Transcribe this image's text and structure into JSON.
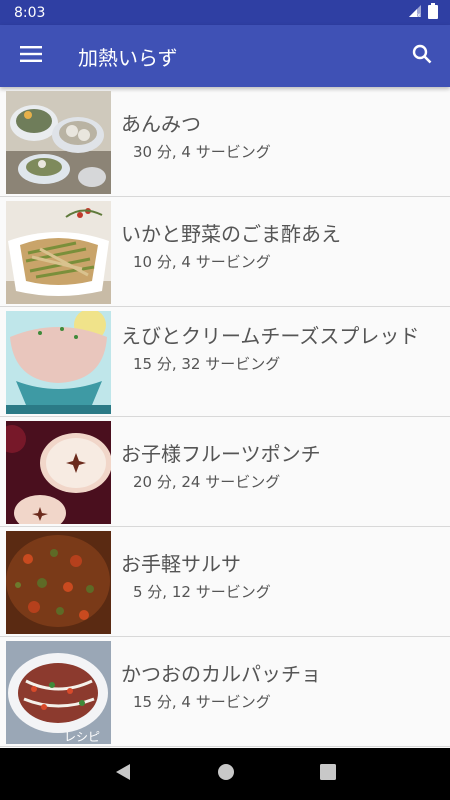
{
  "status": {
    "time": "8:03"
  },
  "appbar": {
    "title": "加熱いらず"
  },
  "recipes": [
    {
      "title": "あんみつ",
      "meta": "30 分, 4 サービング"
    },
    {
      "title": "いかと野菜のごま酢あえ",
      "meta": "10 分, 4 サービング"
    },
    {
      "title": "えびとクリームチーズスプレッド",
      "meta": "15 分, 32 サービング"
    },
    {
      "title": "お子様フルーツポンチ",
      "meta": "20 分, 24 サービング"
    },
    {
      "title": "お手軽サルサ",
      "meta": "5 分, 12 サービング"
    },
    {
      "title": "かつおのカルパッチョ",
      "meta": "15 分, 4 サービング"
    }
  ],
  "thumb_labels": {
    "row6": "レシピ"
  },
  "icons": {
    "menu": "menu-icon",
    "search": "search-icon",
    "signal": "signal-icon",
    "battery": "battery-icon",
    "back": "back-icon",
    "home": "home-icon",
    "recents": "recents-icon"
  },
  "colors": {
    "primary": "#3f51b5",
    "primary_dark": "#2f3fa3",
    "text": "#555555"
  }
}
